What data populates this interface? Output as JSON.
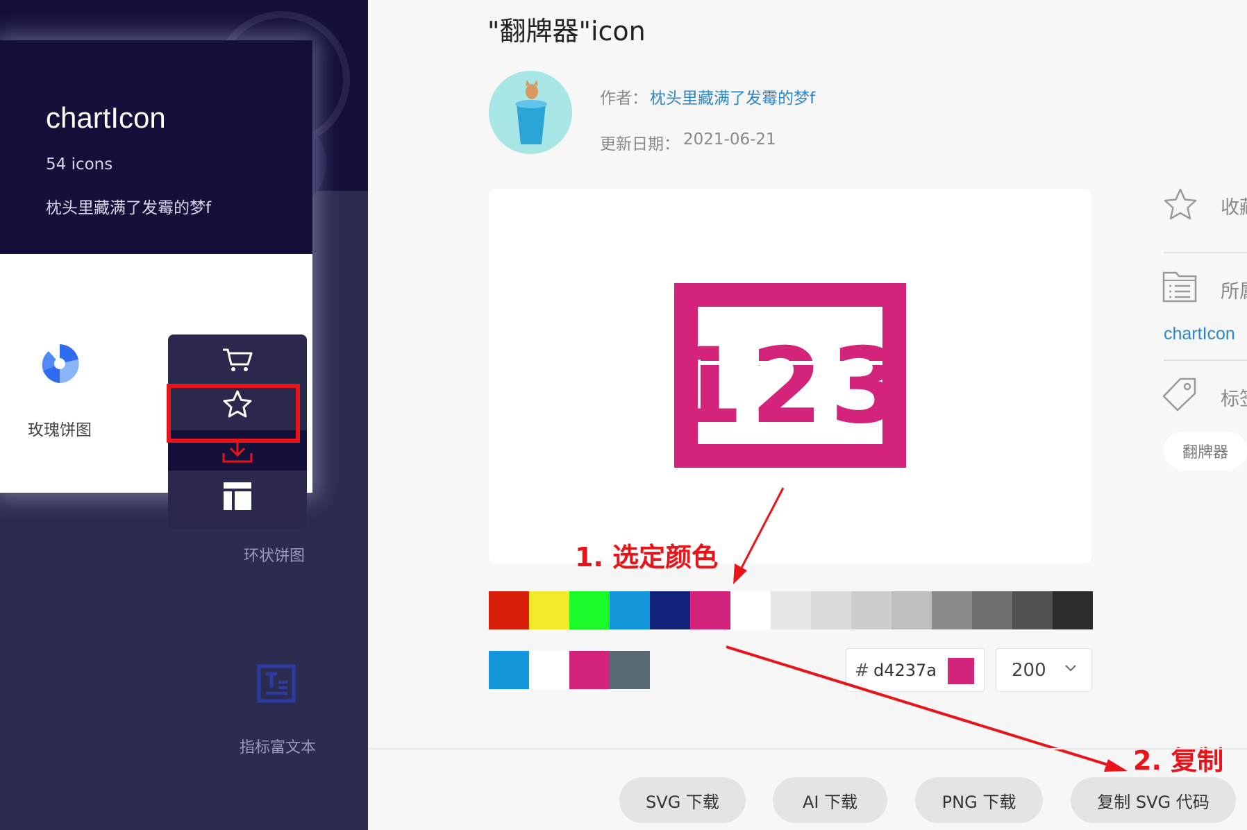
{
  "collection": {
    "title": "chartIcon",
    "count": "54 icons",
    "author": "枕头里藏满了发霉的梦f",
    "items": [
      {
        "label": "玫瑰饼图",
        "icon": "rose-pie-icon"
      },
      {
        "label": "环状饼图",
        "icon": "ring-pie-icon"
      },
      {
        "label": "指标富文本",
        "icon": "rich-text-icon"
      }
    ],
    "actions": [
      "cart-icon",
      "star-icon",
      "download-icon",
      "layout-icon"
    ]
  },
  "icon_page": {
    "title": "\"翻牌器\"icon",
    "author_label": "作者：",
    "author": "枕头里藏满了发霉的梦f",
    "date_label": "更新日期：",
    "date": "2021-06-21",
    "preview_number": "123",
    "preview_color": "#d4237a"
  },
  "palette": {
    "colors": [
      "#d81e06",
      "#f4ea2a",
      "#1afa29",
      "#1296db",
      "#13227a",
      "#d4237a",
      "#ffffff",
      "#e6e6e6",
      "#dbdbdb",
      "#cdcdcd",
      "#bfbfbf",
      "#8a8a8a",
      "#707070",
      "#515151",
      "#2c2c2c"
    ],
    "recent": [
      "#1296db",
      "#ffffff",
      "#d4237a",
      "#5a6a72"
    ]
  },
  "color_input": {
    "hash": "#",
    "value": "d4237a",
    "swatch": "#d4237a"
  },
  "size_select": {
    "value": "200"
  },
  "annotations": {
    "step1": "1. 选定颜色",
    "step2": "2. 复制"
  },
  "buttons": {
    "svg_download": "SVG 下载",
    "ai_download": "AI 下载",
    "png_download": "PNG 下载",
    "copy_svg": "复制 SVG 代码"
  },
  "sidebar": {
    "favorite": "收藏",
    "belongs": "所属",
    "collection_link": "chartIcon",
    "tags": "标签",
    "tag_value": "翻牌器"
  },
  "colors": {
    "accent_red": "#e8141a",
    "link_blue": "#2e86c7",
    "dark_navy": "#13113a"
  }
}
